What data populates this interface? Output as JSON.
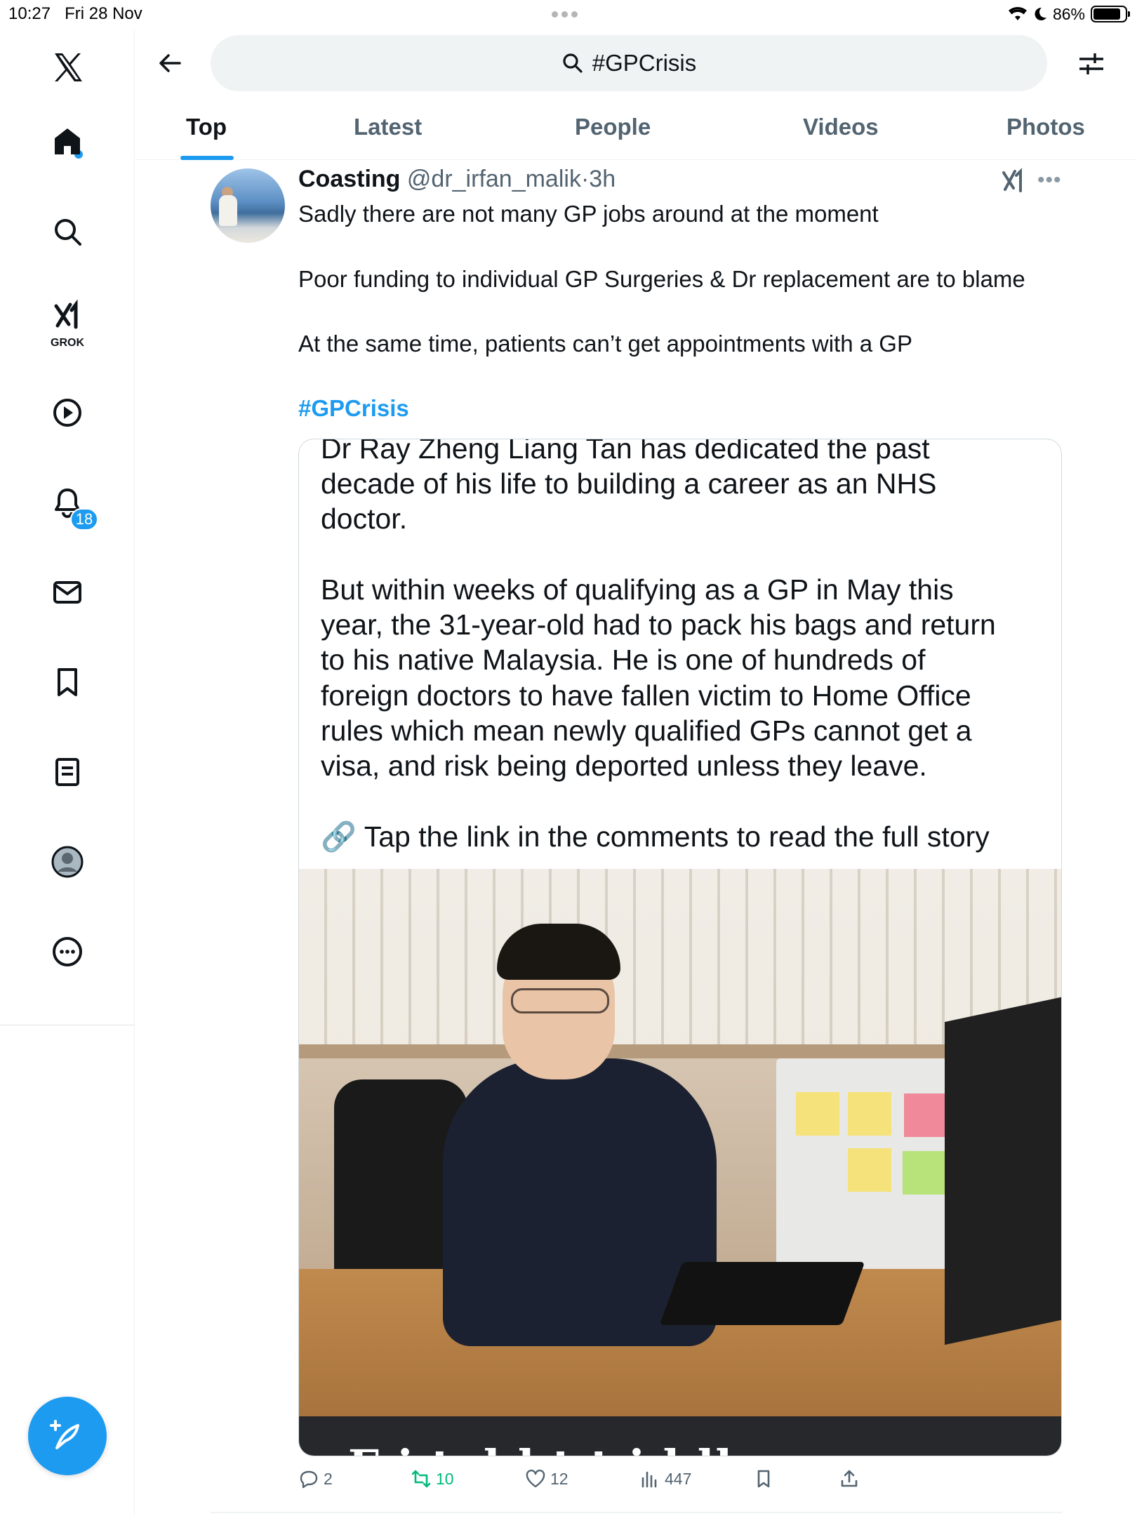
{
  "status_bar": {
    "time": "10:27",
    "date": "Fri 28 Nov",
    "battery": "86%",
    "battery_level": 0.86
  },
  "sidebar": {
    "items": [
      {
        "name": "x-logo-icon"
      },
      {
        "name": "home-icon"
      },
      {
        "name": "search-icon"
      },
      {
        "name": "grok-icon",
        "label": "GROK"
      },
      {
        "name": "video-icon"
      },
      {
        "name": "notifications-icon",
        "badge": "18"
      },
      {
        "name": "messages-icon"
      },
      {
        "name": "bookmarks-icon"
      },
      {
        "name": "lists-icon"
      },
      {
        "name": "profile-icon"
      },
      {
        "name": "more-icon"
      }
    ],
    "compose_icon": "compose-icon"
  },
  "search": {
    "query": "#GPCrisis"
  },
  "tabs": [
    {
      "label": "Top",
      "active": true
    },
    {
      "label": "Latest"
    },
    {
      "label": "People"
    },
    {
      "label": "Videos"
    },
    {
      "label": "Photos"
    }
  ],
  "tweet": {
    "name": "Coasting",
    "handle": "@dr_irfan_malik",
    "separator": "·",
    "time": "3h",
    "lines": [
      "Sadly there are not many GP jobs around at the moment",
      "Poor funding to individual GP Surgeries & Dr replacement are to blame",
      "At the same time, patients can’t get appointments with a GP"
    ],
    "hashtag": "#GPCrisis",
    "card": {
      "lines": [
        "Dr Ray Zheng Liang Tan has dedicated the past",
        "decade of his life to building a career as an NHS",
        "doctor.",
        "But within weeks of qualifying as a GP in May this",
        "year, the 31-year-old had to pack his bags and return",
        "to his native Malaysia. He is one of hundreds of",
        "foreign doctors to have fallen victim to Home Office",
        "rules which mean newly qualified GPs cannot get a",
        "visa, and risk being deported unless they leave."
      ],
      "link_emoji": "🔗",
      "link_line": "Tap the link in the comments to read the full story",
      "headline_fragment": "F      i       t      d       l        t      t      i      l    ll"
    },
    "actions": {
      "replies": "2",
      "reposts": "10",
      "likes": "12",
      "views": "447"
    },
    "colors": {
      "accent": "#1d9bf0",
      "repost": "#00ba7c",
      "muted": "#536471"
    }
  }
}
